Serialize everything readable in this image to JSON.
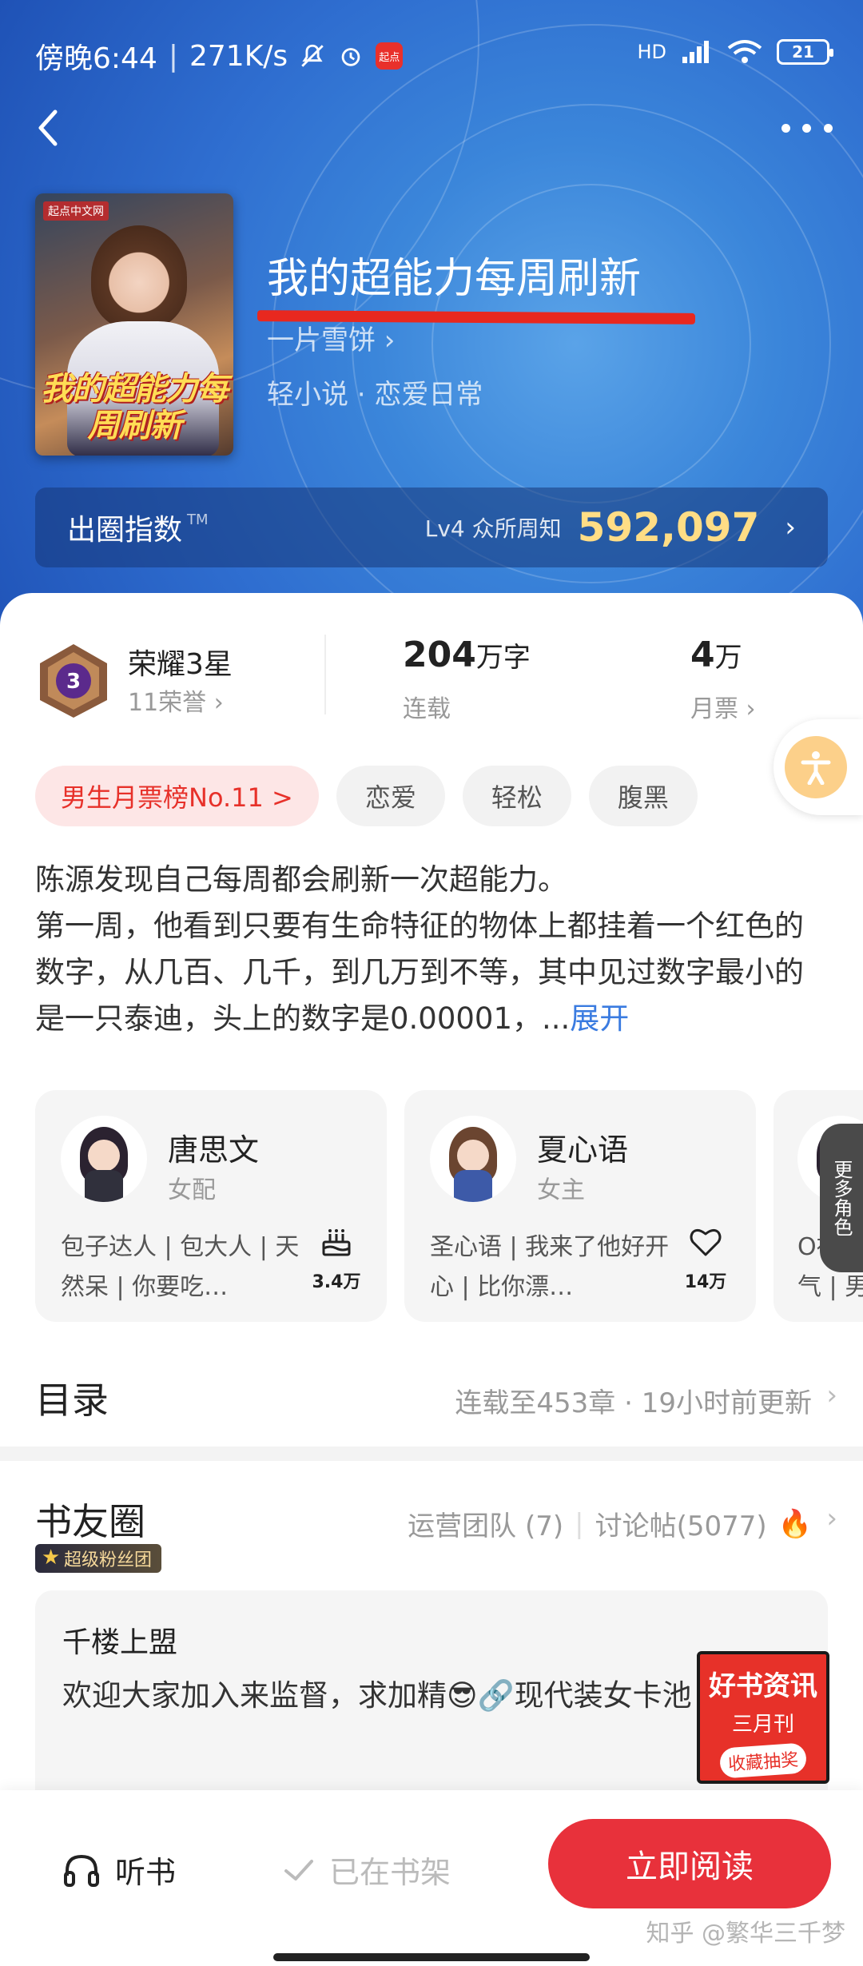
{
  "status": {
    "time": "傍晚6:44",
    "speed": "271K/s",
    "app_badge": "起点",
    "network": "HD",
    "battery": "21"
  },
  "book": {
    "cover_brand": "起点中文网",
    "cover_title": "我的超能力每周刷新",
    "title": "我的超能力每周刷新",
    "author": "一片雪饼 ›",
    "category": "轻小说 · 恋爱日常"
  },
  "index": {
    "label": "出圈指数",
    "tm": "TM",
    "level": "Lv4 众所周知",
    "value": "592,097",
    "arrow": "›"
  },
  "stats": {
    "honor_name": "荣耀3星",
    "honor_level": "3",
    "honor_sub": "11荣誉 ›",
    "words_value": "204",
    "words_unit": "万字",
    "words_sub": "连载",
    "votes_value": "4",
    "votes_unit": "万",
    "votes_sub": "月票 ›"
  },
  "tags": [
    "男生月票榜No.11 >",
    "恋爱",
    "轻松",
    "腹黑"
  ],
  "synopsis": {
    "text": "陈源发现自己每周都会刷新一次超能力。\n第一周，他看到只要有生命特征的物体上都挂着一个红色的数字，从几百、几千，到几万到不等，其中见过数字最小的是一只泰迪，头上的数字是0.00001，...",
    "expand": "展开"
  },
  "roles": [
    {
      "name": "唐思文",
      "type": "女配",
      "desc": "包子达人 | 包大人 | 天然呆 | 你要吃…",
      "stat": "3.4万",
      "icon": "cake-icon"
    },
    {
      "name": "夏心语",
      "type": "女主",
      "desc": "圣心语 | 我来了他好开心 | 比你漂…",
      "stat": "14万",
      "icon": "heart-icon"
    }
  ],
  "roles_partial": {
    "line1": "O神 |",
    "line2": "气 | 男"
  },
  "more_roles": "更多角色",
  "toc": {
    "title": "目录",
    "info": "连载至453章 · 19小时前更新",
    "arrow": "›"
  },
  "circle": {
    "title": "书友圈",
    "badge": "超级粉丝团",
    "ops_team": "运营团队 (7)",
    "sep": "|",
    "discussions": "讨论帖(5077)",
    "fire": "🔥",
    "arrow": "›",
    "post_title": "千楼上盟",
    "post_body": "欢迎大家加入来监督，求加精😎🔗现代装女卡池"
  },
  "promo": {
    "line1": "好书资讯",
    "line2": "三月刊",
    "line3": "收藏抽奖"
  },
  "bottom": {
    "listen": "听书",
    "shelf": "已在书架",
    "read": "立即阅读",
    "watermark": "知乎 @繁华三千梦"
  },
  "colors": {
    "accent_red": "#e8313b",
    "hero_blue": "#2f6ed0",
    "index_gold": "#ffdd85",
    "link_blue": "#3a7be0"
  }
}
